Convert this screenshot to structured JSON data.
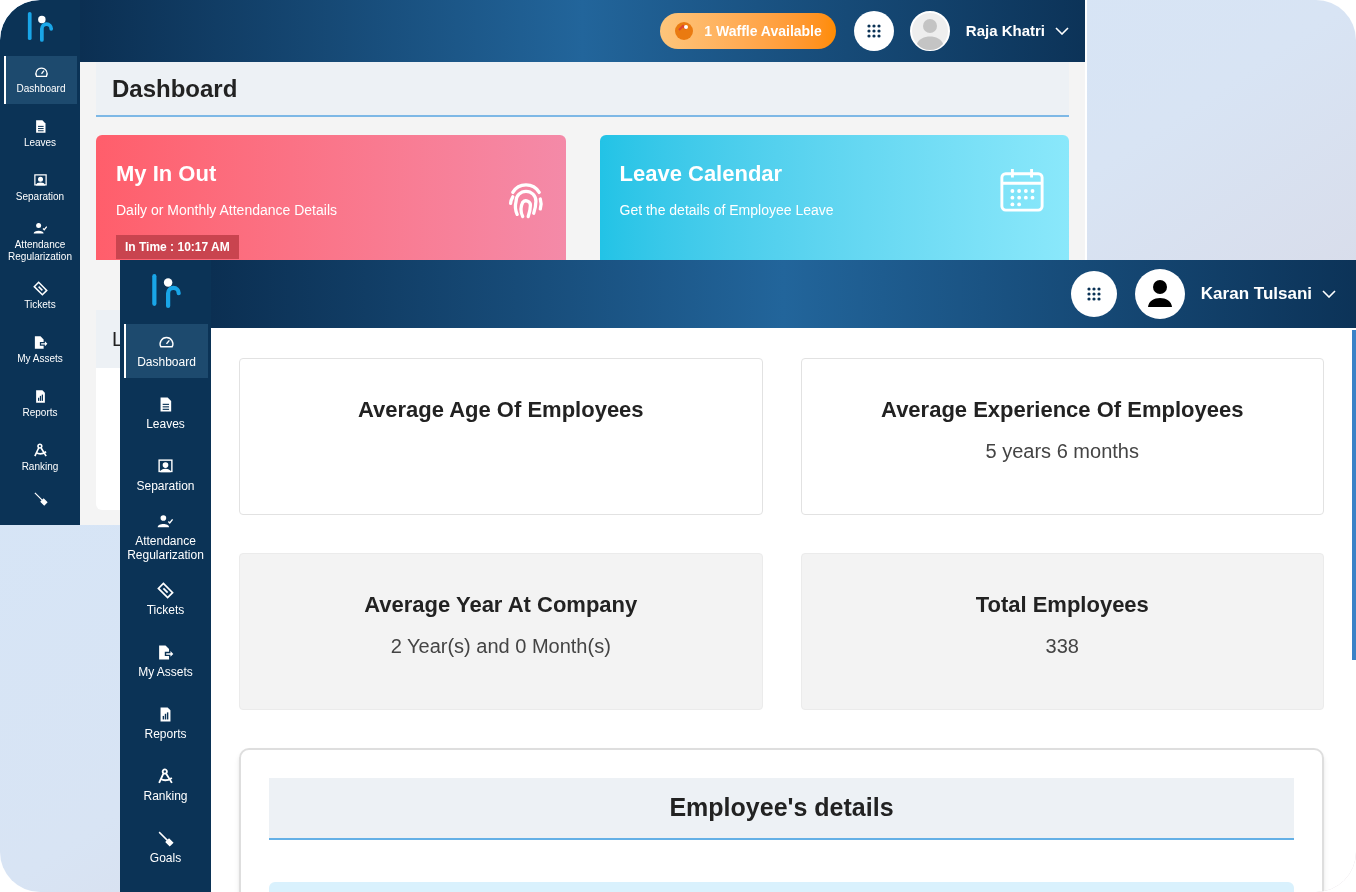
{
  "back_window": {
    "sidebar": [
      {
        "label": "Dashboard",
        "selected": true
      },
      {
        "label": "Leaves",
        "selected": false
      },
      {
        "label": "Separation",
        "selected": false
      },
      {
        "label": "Attendance Regularization",
        "selected": false
      },
      {
        "label": "Tickets",
        "selected": false
      },
      {
        "label": "My Assets",
        "selected": false
      },
      {
        "label": "Reports",
        "selected": false
      },
      {
        "label": "Ranking",
        "selected": false
      },
      {
        "kind": "cut"
      }
    ],
    "header": {
      "waffle_badge": "1 Waffle Available",
      "user_name": "Raja Khatri"
    },
    "page_title": "Dashboard",
    "cards": [
      {
        "kind": "attendance",
        "title": "My In Out",
        "subtitle": "Daily or Monthly Attendance Details",
        "badge": "In Time : 10:17 AM"
      },
      {
        "kind": "calendar",
        "title": "Leave Calendar",
        "subtitle": "Get the details of Employee Leave"
      }
    ],
    "cut_card_title": "L"
  },
  "front_window": {
    "sidebar": [
      {
        "label": "Dashboard",
        "selected": true
      },
      {
        "label": "Leaves",
        "selected": false
      },
      {
        "label": "Separation",
        "selected": false
      },
      {
        "label": "Attendance Regularization",
        "selected": false
      },
      {
        "label": "Tickets",
        "selected": false
      },
      {
        "label": "My Assets",
        "selected": false
      },
      {
        "label": "Reports",
        "selected": false
      },
      {
        "label": "Ranking",
        "selected": false
      },
      {
        "label": "Goals",
        "selected": false
      }
    ],
    "header": {
      "user_name": "Karan Tulsani"
    },
    "stats": [
      {
        "kind": "outlined",
        "title": "Average Age Of Employees"
      },
      {
        "kind": "outlined",
        "title": "Average Experience Of Employees",
        "value": "5 years 6 months"
      },
      {
        "kind": "filled",
        "title": "Average Year At Company",
        "value": "2 Year(s) and 0 Month(s)"
      },
      {
        "kind": "filled",
        "title": "Total Employees",
        "value": "338"
      }
    ],
    "details_title": "Employee's details"
  }
}
